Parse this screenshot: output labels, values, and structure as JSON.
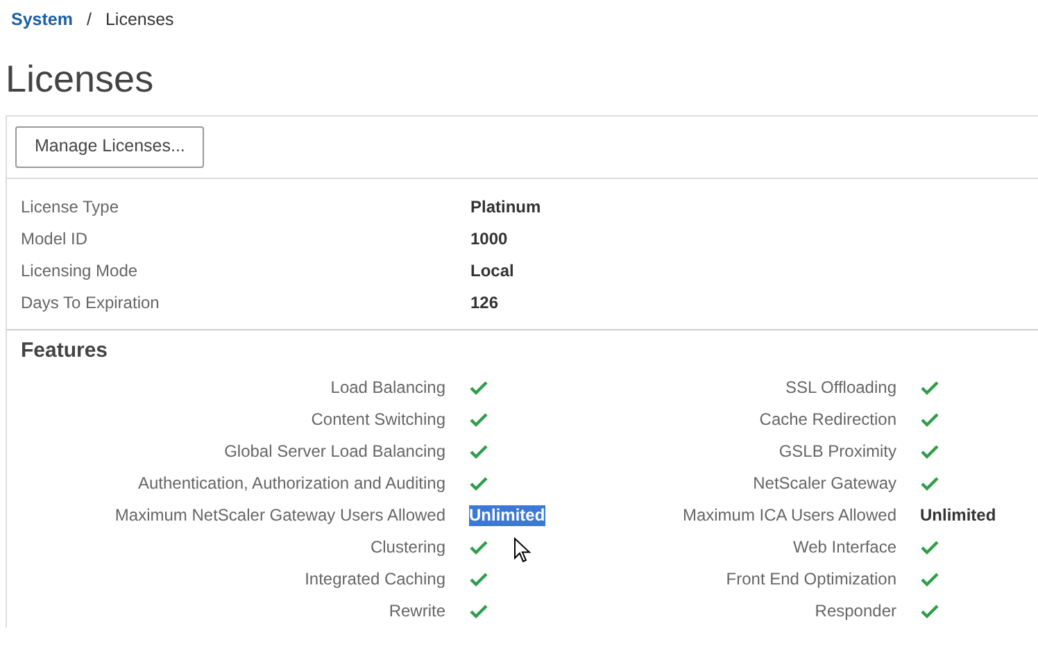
{
  "breadcrumb": {
    "parent": "System",
    "separator": "/",
    "current": "Licenses"
  },
  "title": "Licenses",
  "manage_button": "Manage Licenses...",
  "details": [
    {
      "label": "License Type",
      "value": "Platinum"
    },
    {
      "label": "Model ID",
      "value": "1000"
    },
    {
      "label": "Licensing Mode",
      "value": "Local"
    },
    {
      "label": "Days To Expiration",
      "value": "126"
    }
  ],
  "features_title": "Features",
  "features": [
    {
      "kind": "check",
      "label": "Load Balancing"
    },
    {
      "kind": "check",
      "label": "SSL Offloading"
    },
    {
      "kind": "check",
      "label": "Content Switching"
    },
    {
      "kind": "check",
      "label": "Cache Redirection"
    },
    {
      "kind": "check",
      "label": "Global Server Load Balancing"
    },
    {
      "kind": "check",
      "label": "GSLB Proximity"
    },
    {
      "kind": "check",
      "label": "Authentication, Authorization and Auditing"
    },
    {
      "kind": "check",
      "label": "NetScaler Gateway"
    },
    {
      "kind": "text",
      "label": "Maximum NetScaler Gateway Users Allowed",
      "value": "Unlimited",
      "highlighted": true
    },
    {
      "kind": "text",
      "label": "Maximum ICA Users Allowed",
      "value": "Unlimited",
      "highlighted": false
    },
    {
      "kind": "check",
      "label": "Clustering"
    },
    {
      "kind": "check",
      "label": "Web Interface"
    },
    {
      "kind": "check",
      "label": "Integrated Caching"
    },
    {
      "kind": "check",
      "label": "Front End Optimization"
    },
    {
      "kind": "check",
      "label": "Rewrite"
    },
    {
      "kind": "check",
      "label": "Responder"
    }
  ]
}
